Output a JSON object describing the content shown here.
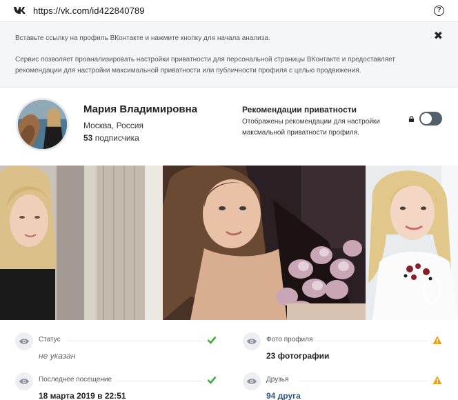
{
  "url_bar": {
    "logo_icon": "vk-logo-icon",
    "url": "https://vk.com/id422840789",
    "help_icon": "question-circle-icon",
    "help_glyph": "?"
  },
  "info_box": {
    "line1": "Вставьте ссылку на профиль ВКонтакте и нажмите кнопку для начала анализа.",
    "line2": "Сервис позволяет проанализировать настройки приватности для персональной страницы ВКонтакте и предоставляет рекомендации для настройки максимальной приватности или публичности профиля с целью продвижения.",
    "close_icon": "close-icon",
    "close_glyph": "✖"
  },
  "profile": {
    "name": "Мария Владимировна",
    "city": "Москва, Россия",
    "subscribers_count": "53",
    "subscribers_label": "подписчика"
  },
  "recommendations": {
    "title": "Рекомендации приватности",
    "description": "Отображены рекомендации для настройки максмальной приватности профиля.",
    "lock_icon": "lock-icon",
    "toggle_on": false
  },
  "stats": {
    "status": {
      "label": "Статус",
      "value": "не указан",
      "mark": "check-icon"
    },
    "profile_photo": {
      "label": "Фото профиля",
      "value": "23 фотографии",
      "mark": "warning-icon"
    },
    "last_seen": {
      "label": "Последнее посещение",
      "value": "18 марта 2019 в 22:51",
      "mark": "check-icon"
    },
    "friends": {
      "label": "Друзья",
      "value": "94 друга",
      "mark": "warning-icon"
    }
  },
  "colors": {
    "check": "#3aab3e",
    "warning": "#e2a21b",
    "toggle": "#51606b",
    "link": "#2a5885"
  }
}
